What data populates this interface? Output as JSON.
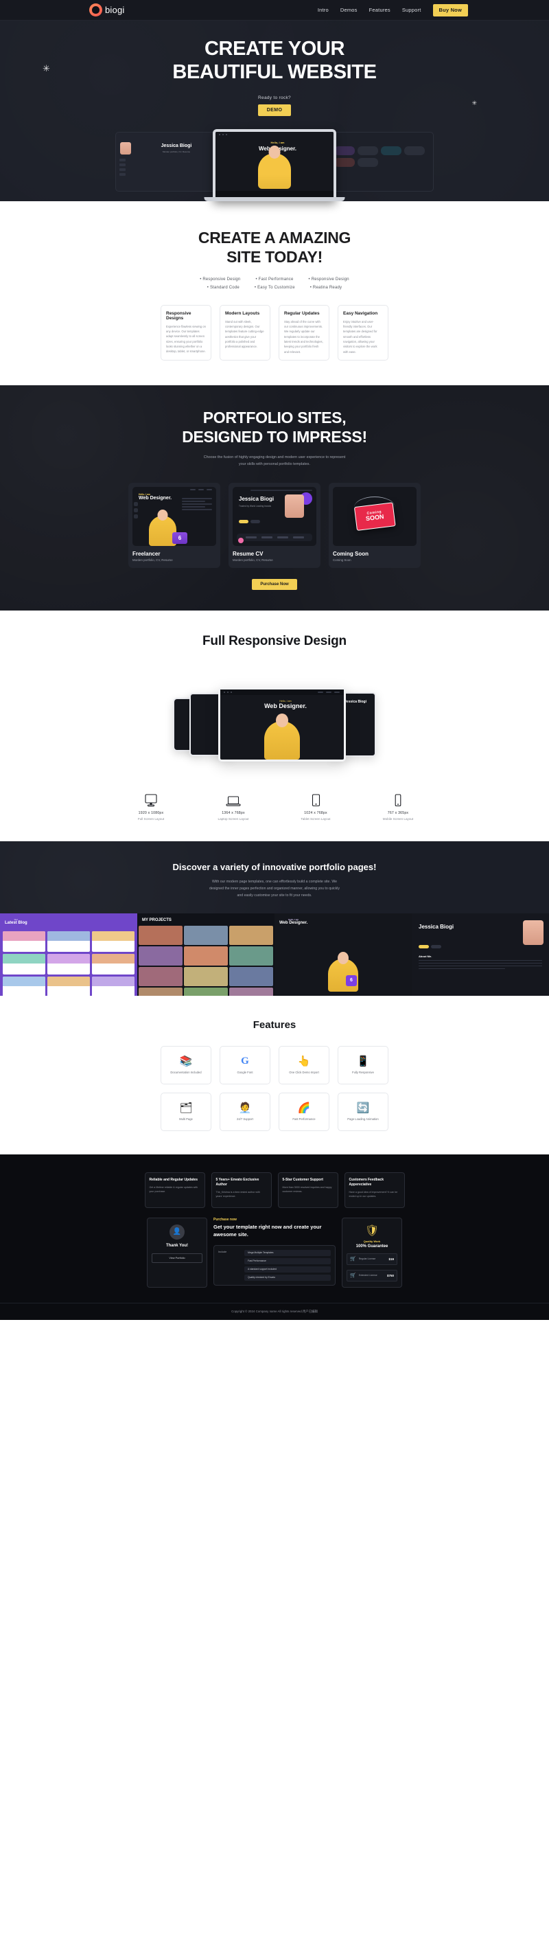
{
  "header": {
    "logo_text": "biogi",
    "nav": [
      {
        "label": "Intro"
      },
      {
        "label": "Demos"
      },
      {
        "label": "Features"
      },
      {
        "label": "Support"
      }
    ],
    "buy_button": "Buy Now"
  },
  "hero": {
    "title_line1": "CREATE YOUR",
    "title_line2": "BEAUTIFUL WEBSITE",
    "ready_text": "Ready to rock?",
    "demo_button": "DEMO",
    "device_center_title": "Web Designer.",
    "device_center_kicker": "Hello, I am",
    "device_left_name": "Jessica Biogi",
    "device_left_sub": "Morden portfolio, CV, Resume"
  },
  "amazing": {
    "title_line1": "CREATE A AMAZING",
    "title_line2": "SITE TODAY!",
    "bullets_row1": [
      "Responsive Design",
      "Fast Performance",
      "Responsive Design"
    ],
    "bullets_row2": [
      "Standard Code",
      "Easy To Customize",
      "Reatina Ready"
    ],
    "cards": [
      {
        "title": "Responsive Designs",
        "body": "Experience flawless viewing on any device. Our templates adapt seamlessly to all screen sizes, ensuring your portfolio looks stunning whether on a desktop, tablet, or smartphone."
      },
      {
        "title": "Modern Layouts",
        "body": "Stand out with sleek, contemporary designs. Our templates feature cutting-edge aesthetics that give your portfolio a polished and professional appearance."
      },
      {
        "title": "Regular Updates",
        "body": "Stay ahead of the curve with our continuous improvements. We regularly update our templates to incorporate the latest trends and technologies, keeping your portfolio fresh and relevant."
      },
      {
        "title": "Easy Navigation",
        "body": "Enjoy intuitive and user-friendly interfaces. Our templates are designed for smooth and effortless navigation, allowing your visitors to explore the work with ease."
      }
    ]
  },
  "portfolio": {
    "title_line1": "PORTFOLIO SITES,",
    "title_line2": "DESIGNED TO IMPRESS!",
    "subtitle_line1": "Choose the fusion of highly engaging design and modern user experience to represent",
    "subtitle_line2": "your skills with personal portfolio templates.",
    "cards": [
      {
        "title": "Freelancer",
        "subtitle": "Morden portfolio, CV, Resume",
        "thumb_kicker": "Hello, I am",
        "thumb_title": "Web Designer.",
        "badge": "6"
      },
      {
        "title": "Resume CV",
        "subtitle": "Morden portfolio, CV, Resume",
        "thumb_name": "Jessica Biogi",
        "thumb_sub": "Trusted by World Leading brands"
      },
      {
        "title": "Coming Soon",
        "subtitle": "Coming Soon",
        "sign_line1": "Coming",
        "sign_line2": "SOON"
      }
    ],
    "purchase_button": "Purchase Now"
  },
  "responsive": {
    "title": "Full Responsive Design",
    "screen_kicker": "Hello, I am",
    "screen_title": "Web Designer.",
    "side_name": "Jessica Biogi",
    "devices": [
      {
        "icon": "monitor-icon",
        "px": "1920 x 1080px",
        "label": "Full Screen Layout"
      },
      {
        "icon": "laptop-icon",
        "px": "1364 x 768px",
        "label": "Laptop Screen Layout"
      },
      {
        "icon": "tablet-icon",
        "px": "1024 x 768px",
        "label": "Tablet Screen Layout"
      },
      {
        "icon": "mobile-icon",
        "px": "767 x 365px",
        "label": "Mobile Screen Layout"
      }
    ]
  },
  "discover": {
    "title": "Discover a variety of innovative portfolio pages!",
    "subtitle_line1": "With our modern page templates, one can effortlessly build a complete site. We",
    "subtitle_line2": "designed the inner pages perfection and organized manner, allowing you to quickly",
    "subtitle_line3": "and easily customise your site to fit your needs.",
    "panels": [
      {
        "title": "Latest Blog",
        "kicker": "Our"
      },
      {
        "title": "MY PROJECTS",
        "kicker": ""
      },
      {
        "title": "Web Designer.",
        "kicker": "Hello, I am",
        "badge": "6"
      },
      {
        "title": "Jessica Biogi",
        "about": "About Me."
      }
    ]
  },
  "features": {
    "title": "Features",
    "items": [
      {
        "icon": "books-icon",
        "glyph": "📚",
        "label": "Documentation Included"
      },
      {
        "icon": "google-font-icon",
        "glyph": "G",
        "label": "Google Font"
      },
      {
        "icon": "click-icon",
        "glyph": "👆",
        "label": "One Click Demo Import"
      },
      {
        "icon": "mobile-responsive-icon",
        "glyph": "📱",
        "label": "Fully Responsive"
      },
      {
        "icon": "multipage-icon",
        "glyph": "🗂",
        "label": "Multi Page"
      },
      {
        "icon": "support-icon",
        "glyph": "🧑‍💼",
        "label": "24/7 Support"
      },
      {
        "icon": "speed-icon",
        "glyph": "🌈",
        "label": "Fast Performance"
      },
      {
        "icon": "loading-animation-icon",
        "glyph": "🔄",
        "label": "Page Loading Animation"
      }
    ]
  },
  "footer": {
    "cards": [
      {
        "title": "Reliable and Regular Updates",
        "body": "Get a lifetime reliable & regular updates with your purchase."
      },
      {
        "title": "5 Years+ Envato Exclusive Author",
        "body": "The_Krishna is a time-tested author with years' experience."
      },
      {
        "title": "5-Star Customer Support",
        "body": "More than 3000 resolved inquiries and happy customer reviews."
      },
      {
        "title": "Customers Feedback Appereciative",
        "body": "Have a good idea of improvement? It can be ended up in our updates."
      }
    ],
    "testimonial": {
      "avatar_icon": "user-avatar-icon",
      "thanks": "Thank You!",
      "button": "View Portfolio"
    },
    "pitch": {
      "kicker": "Purchase now",
      "headline": "Get your template right now and create your awesome site.",
      "include_label": "Include",
      "tags": [
        "Mega Multiple Templates",
        "Fast Performance",
        "A standard support included",
        "Quality checked by Envato"
      ]
    },
    "guarantee": {
      "shield_icon": "shield-icon",
      "quality": "Quality Work",
      "title": "100% Guarantee",
      "rows": [
        {
          "icon": "cart-icon",
          "label": "Regular License",
          "price": "$19"
        },
        {
          "icon": "cart-icon",
          "label": "Extended License",
          "price": "$750"
        }
      ]
    },
    "copyright": "Copyright © 2024 Company name All rights reserved.用户已编辑"
  }
}
